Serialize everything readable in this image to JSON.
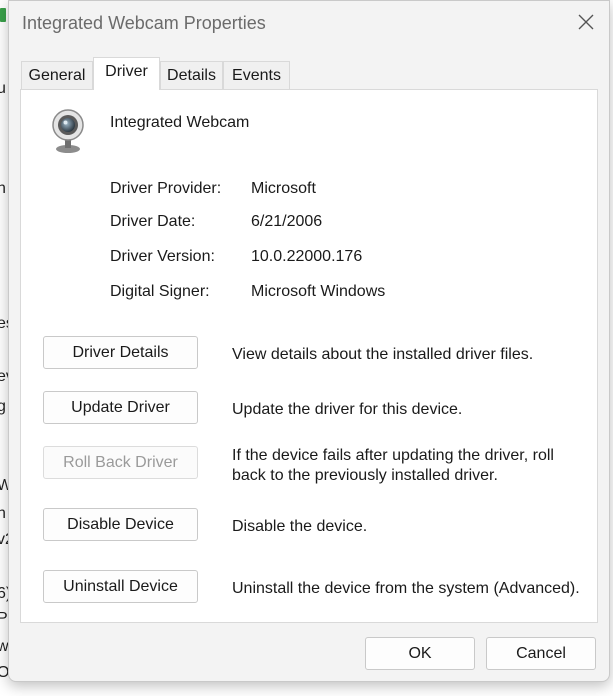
{
  "window": {
    "title": "Integrated Webcam Properties"
  },
  "background_fragments": [
    "u",
    "n",
    "es",
    "ev",
    "g",
    "W",
    "n",
    "v2",
    "6)",
    "P",
    "w",
    "Oc"
  ],
  "tabs": [
    {
      "label": "General"
    },
    {
      "label": "Driver"
    },
    {
      "label": "Details"
    },
    {
      "label": "Events"
    }
  ],
  "active_tab": "Driver",
  "device": {
    "name": "Integrated Webcam",
    "icon": "webcam-icon"
  },
  "driver_info": {
    "provider_label": "Driver Provider:",
    "provider_value": "Microsoft",
    "date_label": "Driver Date:",
    "date_value": "6/21/2006",
    "version_label": "Driver Version:",
    "version_value": "10.0.22000.176",
    "signer_label": "Digital Signer:",
    "signer_value": "Microsoft Windows"
  },
  "actions": [
    {
      "label": "Driver Details",
      "description": "View details about the installed driver files.",
      "enabled": true
    },
    {
      "label": "Update Driver",
      "description": "Update the driver for this device.",
      "enabled": true
    },
    {
      "label": "Roll Back Driver",
      "description": "If the device fails after updating the driver, roll back to the previously installed driver.",
      "enabled": false
    },
    {
      "label": "Disable Device",
      "description": "Disable the device.",
      "enabled": true
    },
    {
      "label": "Uninstall Device",
      "description": "Uninstall the device from the system (Advanced).",
      "enabled": true
    }
  ],
  "footer": {
    "ok_label": "OK",
    "cancel_label": "Cancel"
  },
  "colors": {
    "dialog_bg": "#f3f3f3",
    "panel_bg": "#ffffff",
    "disabled_text": "#9a9a9a"
  }
}
